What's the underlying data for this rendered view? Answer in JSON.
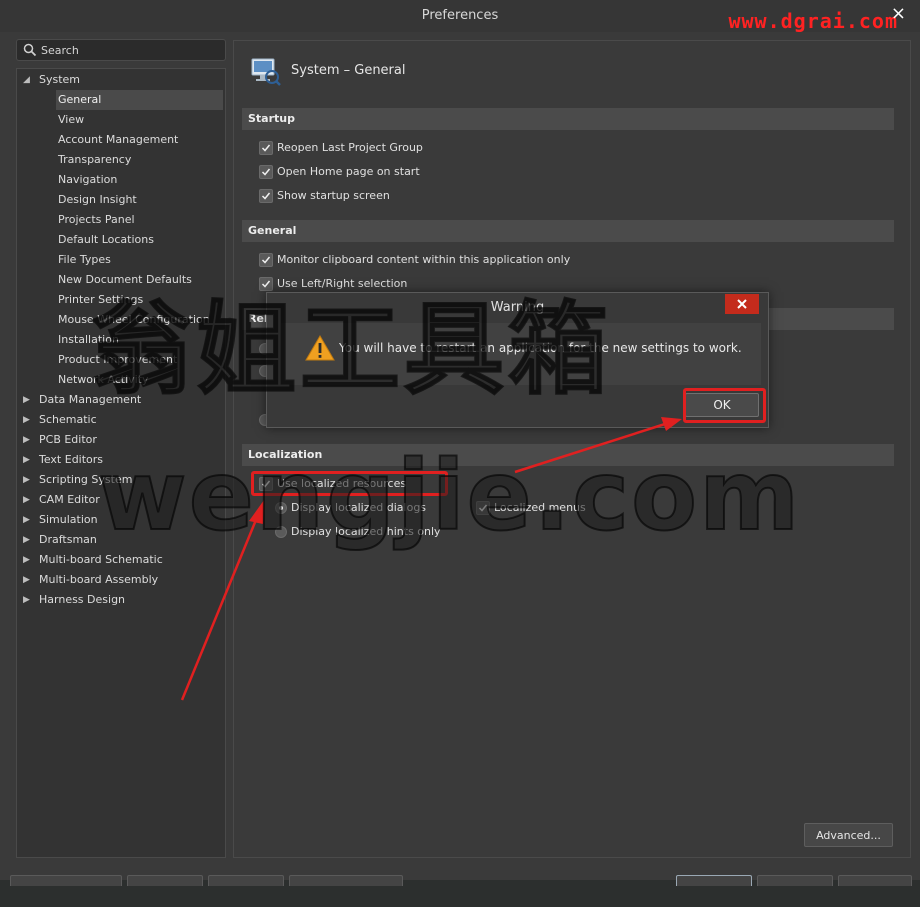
{
  "window": {
    "title": "Preferences",
    "watermark_url": "www.dgrai.com",
    "close_glyph": "×"
  },
  "search": {
    "placeholder": "Search"
  },
  "tree": {
    "items": [
      {
        "label": "System",
        "expanded": true
      },
      {
        "label": "General",
        "selected": true
      },
      {
        "label": "View"
      },
      {
        "label": "Account Management"
      },
      {
        "label": "Transparency"
      },
      {
        "label": "Navigation"
      },
      {
        "label": "Design Insight"
      },
      {
        "label": "Projects Panel"
      },
      {
        "label": "Default Locations"
      },
      {
        "label": "File Types"
      },
      {
        "label": "New Document Defaults"
      },
      {
        "label": "Printer Settings"
      },
      {
        "label": "Mouse Wheel Configuration"
      },
      {
        "label": "Installation"
      },
      {
        "label": "Product Improvement"
      },
      {
        "label": "Network Activity"
      },
      {
        "label": "Data Management"
      },
      {
        "label": "Schematic"
      },
      {
        "label": "PCB Editor"
      },
      {
        "label": "Text Editors"
      },
      {
        "label": "Scripting System"
      },
      {
        "label": "CAM Editor"
      },
      {
        "label": "Simulation"
      },
      {
        "label": "Draftsman"
      },
      {
        "label": "Multi-board Schematic"
      },
      {
        "label": "Multi-board Assembly"
      },
      {
        "label": "Harness Design"
      }
    ]
  },
  "page": {
    "title": "System – General"
  },
  "startup": {
    "header": "Startup",
    "reopen": "Reopen Last Project Group",
    "home": "Open Home page on start",
    "splash": "Show startup screen"
  },
  "general": {
    "header": "General",
    "clipboard": "Monitor clipboard content within this application only",
    "leftright": "Use Left/Right selection"
  },
  "hidden_section": {
    "header_fragment": "Rel"
  },
  "localization": {
    "header": "Localization",
    "use_localized": "Use localized resources",
    "display_dialogs": "Display localized dialogs",
    "display_hints": "Display localized hints only",
    "localized_menus": "Localized menus"
  },
  "buttons": {
    "advanced": "Advanced..."
  },
  "dialog": {
    "title": "Warning",
    "message": "You will have to restart an application for the new settings to work.",
    "ok": "OK"
  },
  "watermarks": {
    "cn": "翁姐工具箱",
    "domain": "wengjie.com"
  },
  "colors": {
    "highlight": "#e02020",
    "close_button": "#c42b1c",
    "warning": "#f0a020"
  }
}
